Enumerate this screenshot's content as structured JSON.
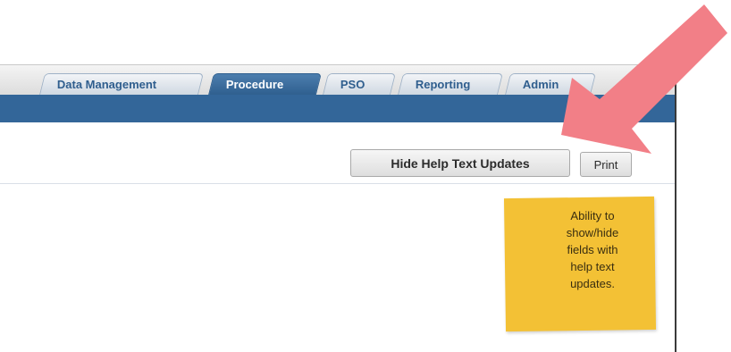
{
  "tabs": [
    {
      "label": "Data Management",
      "active": false
    },
    {
      "label": "Procedure",
      "active": true
    },
    {
      "label": "PSO",
      "active": false
    },
    {
      "label": "Reporting",
      "active": false
    },
    {
      "label": "Admin",
      "active": false
    }
  ],
  "toolbar": {
    "hide_help_label": "Hide Help Text Updates",
    "print_label": "Print"
  },
  "note": {
    "text": "Ability to\nshow/hide\nfields with\nhelp text\nupdates."
  },
  "colors": {
    "nav_blue": "#336699",
    "sticky_note": "#f3c135",
    "arrow": "#f27f87"
  },
  "icons": {
    "callout": "arrow-icon"
  }
}
